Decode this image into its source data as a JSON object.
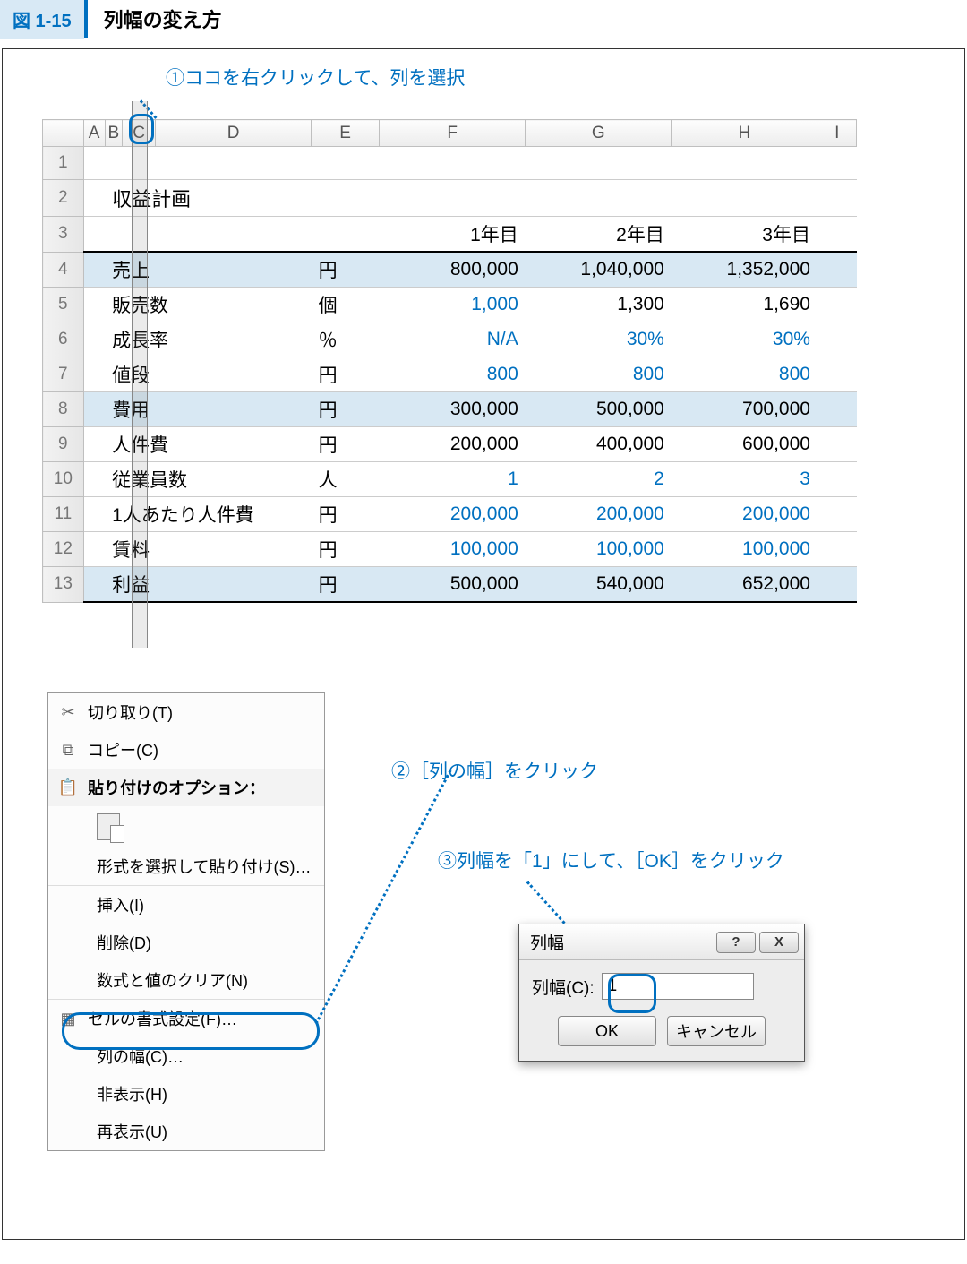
{
  "figure": {
    "tag": "図 1-15",
    "title": "列幅の変え方"
  },
  "annotations": {
    "a1": "①ココを右クリックして、列を選択",
    "a2": "②［列の幅］をクリック",
    "a3": "③列幅を「1」にして、［OK］をクリック"
  },
  "sheet": {
    "cols": [
      "",
      "A",
      "B",
      "C",
      "D",
      "E",
      "F",
      "G",
      "H",
      "I"
    ],
    "rows": [
      "1",
      "2",
      "3",
      "4",
      "5",
      "6",
      "7",
      "8",
      "9",
      "10",
      "11",
      "12",
      "13"
    ],
    "title": "収益計画",
    "years": [
      "1年目",
      "2年目",
      "3年目"
    ],
    "data": [
      {
        "label": "売上",
        "unit": "円",
        "v": [
          "800,000",
          "1,040,000",
          "1,352,000"
        ],
        "hl": true,
        "blue": [
          false,
          false,
          false
        ]
      },
      {
        "label": "販売数",
        "unit": "個",
        "v": [
          "1,000",
          "1,300",
          "1,690"
        ],
        "hl": false,
        "blue": [
          true,
          false,
          false
        ]
      },
      {
        "label": "成長率",
        "unit": "％",
        "v": [
          "N/A",
          "30%",
          "30%"
        ],
        "hl": false,
        "blue": [
          true,
          true,
          true
        ]
      },
      {
        "label": "値段",
        "unit": "円",
        "v": [
          "800",
          "800",
          "800"
        ],
        "hl": false,
        "blue": [
          true,
          true,
          true
        ]
      },
      {
        "label": "費用",
        "unit": "円",
        "v": [
          "300,000",
          "500,000",
          "700,000"
        ],
        "hl": true,
        "blue": [
          false,
          false,
          false
        ]
      },
      {
        "label": "人件費",
        "unit": "円",
        "v": [
          "200,000",
          "400,000",
          "600,000"
        ],
        "hl": false,
        "blue": [
          false,
          false,
          false
        ]
      },
      {
        "label": "従業員数",
        "unit": "人",
        "v": [
          "1",
          "2",
          "3"
        ],
        "hl": false,
        "blue": [
          true,
          true,
          true
        ]
      },
      {
        "label": "1人あたり人件費",
        "unit": "円",
        "v": [
          "200,000",
          "200,000",
          "200,000"
        ],
        "hl": false,
        "blue": [
          true,
          true,
          true
        ]
      },
      {
        "label": "賃料",
        "unit": "円",
        "v": [
          "100,000",
          "100,000",
          "100,000"
        ],
        "hl": false,
        "blue": [
          true,
          true,
          true
        ]
      },
      {
        "label": "利益",
        "unit": "円",
        "v": [
          "500,000",
          "540,000",
          "652,000"
        ],
        "hl": true,
        "blue": [
          false,
          false,
          false
        ]
      }
    ]
  },
  "ctxmenu": {
    "cut": "切り取り(T)",
    "copy": "コピー(C)",
    "pasteopt": "貼り付けのオプション：",
    "pastespecial": "形式を選択して貼り付け(S)…",
    "insert": "挿入(I)",
    "delete": "削除(D)",
    "clear": "数式と値のクリア(N)",
    "format": "セルの書式設定(F)…",
    "colwidth": "列の幅(C)…",
    "hide": "非表示(H)",
    "unhide": "再表示(U)"
  },
  "dialog": {
    "title": "列幅",
    "label": "列幅(C):",
    "value": "1",
    "ok": "OK",
    "cancel": "キャンセル",
    "help": "?",
    "close": "X"
  }
}
